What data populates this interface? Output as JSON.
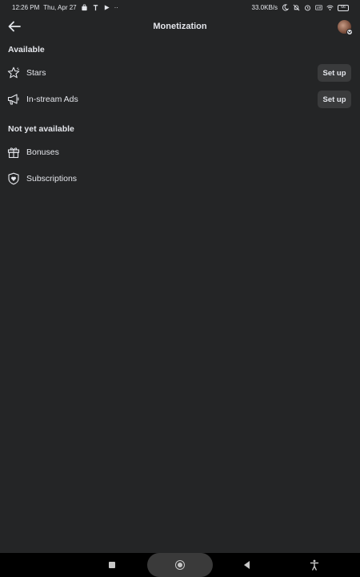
{
  "status_bar": {
    "time": "12:26 PM",
    "date": "Thu, Apr 27",
    "overflow": "··",
    "network_speed": "33.0KB/s",
    "battery": "66"
  },
  "header": {
    "title": "Monetization",
    "back_icon": "arrow-left-icon",
    "avatar_badge_icon": "chevron-down-icon"
  },
  "sections": {
    "available": {
      "title": "Available",
      "items": [
        {
          "label": "Stars",
          "icon": "star-icon",
          "button": "Set up"
        },
        {
          "label": "In-stream Ads",
          "icon": "megaphone-icon",
          "button": "Set up"
        }
      ]
    },
    "not_available": {
      "title": "Not yet available",
      "items": [
        {
          "label": "Bonuses",
          "icon": "gift-icon"
        },
        {
          "label": "Subscriptions",
          "icon": "shield-heart-icon"
        }
      ]
    }
  },
  "colors": {
    "background": "#242526",
    "text": "#e4e6eb",
    "button_bg": "#3a3b3c",
    "nav_bar": "#000000"
  }
}
